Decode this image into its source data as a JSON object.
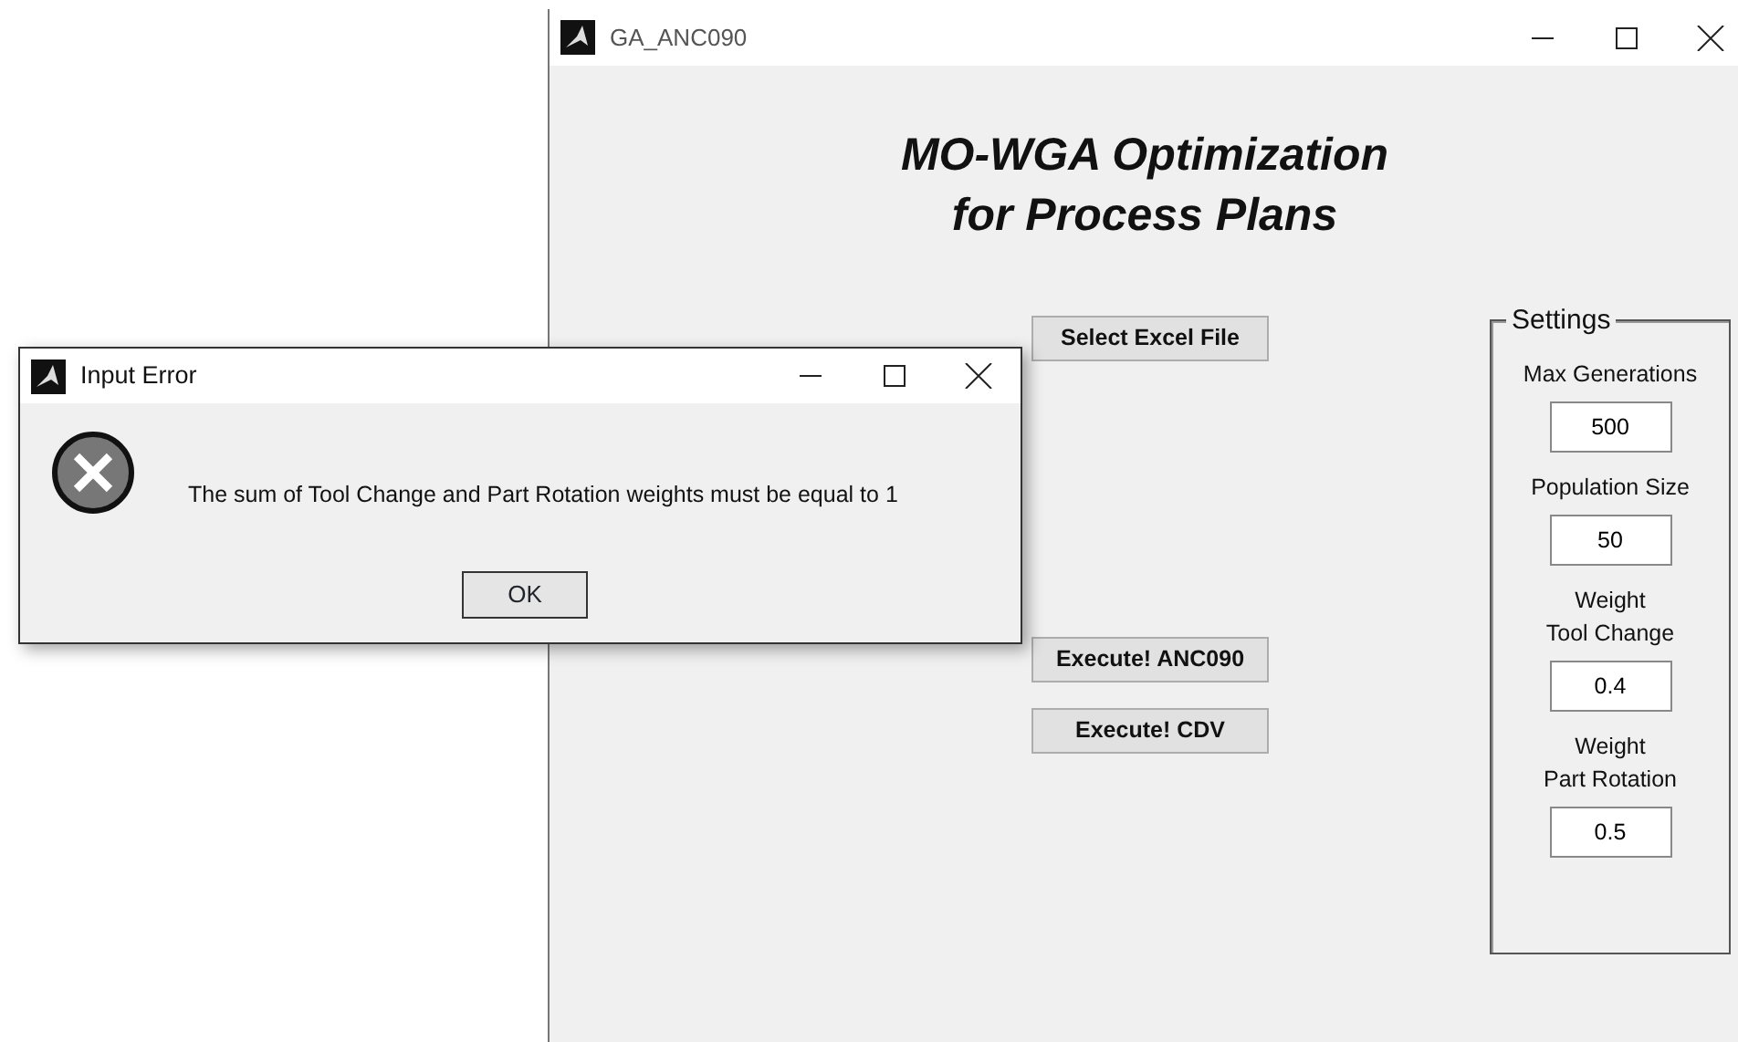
{
  "main_window": {
    "title": "GA_ANC090",
    "heading": [
      "MO-WGA Optimization",
      "for Process Plans"
    ],
    "buttons": [
      {
        "label": "Select Excel File"
      },
      {
        "label": "Execute! ANC090"
      },
      {
        "label": "Execute! CDV"
      }
    ],
    "settings": {
      "title": "Settings",
      "fields": [
        {
          "label": [
            "Max Generations"
          ],
          "value": "500"
        },
        {
          "label": [
            "Population Size"
          ],
          "value": "50"
        },
        {
          "label": [
            "Weight",
            "Tool Change"
          ],
          "value": "0.4"
        },
        {
          "label": [
            "Weight",
            "Part Rotation"
          ],
          "value": "0.5"
        }
      ]
    }
  },
  "dialog": {
    "title": "Input Error",
    "message": "The sum of Tool Change and Part Rotation weights must be equal to 1",
    "buttons": [
      "OK"
    ]
  }
}
